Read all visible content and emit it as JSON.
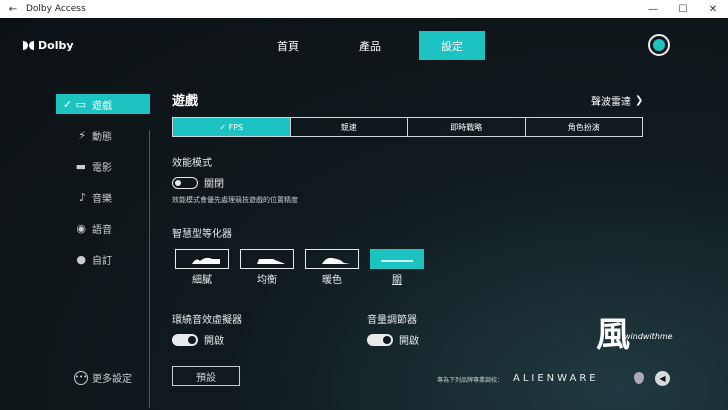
{
  "window": {
    "title": "Dolby Access",
    "back_icon": "back-arrow-icon",
    "controls": [
      "—",
      "☐",
      "✕"
    ]
  },
  "brand": {
    "logo_text": "Dolby",
    "accent": "#1cc3c0"
  },
  "topnav": {
    "tabs": [
      {
        "label": "首頁"
      },
      {
        "label": "產品"
      },
      {
        "label": "設定"
      }
    ],
    "active_index": 2
  },
  "sidebar": {
    "items": [
      {
        "label": "遊戲",
        "icon": "gamepad-icon",
        "active": true
      },
      {
        "label": "動態",
        "icon": "lightning-icon"
      },
      {
        "label": "電影",
        "icon": "clapperboard-icon"
      },
      {
        "label": "音樂",
        "icon": "music-note-icon"
      },
      {
        "label": "語音",
        "icon": "voice-icon"
      },
      {
        "label": "自訂",
        "icon": "user-icon"
      }
    ],
    "more_settings": "更多設定"
  },
  "main": {
    "title": "遊戲",
    "radar_link": "聲波雷達",
    "segments": [
      "FPS",
      "競速",
      "即時戰略",
      "角色扮演"
    ],
    "active_segment": 0,
    "performance_mode": {
      "label": "效能模式",
      "state": "關閉",
      "on": false,
      "description": "效能模式會優先處理競技遊戲的位置精度"
    },
    "equalizer": {
      "label": "智慧型等化器",
      "presets": [
        "細膩",
        "均衡",
        "暖色",
        "關"
      ],
      "active_index": 3
    },
    "surround": {
      "label": "環繞音效虛擬器",
      "state": "開啟",
      "on": true
    },
    "volume_leveler": {
      "label": "音量調節器",
      "state": "開啟",
      "on": true
    },
    "reset_label": "預設"
  },
  "footer": {
    "text": "專為下列品牌專業調校：",
    "brand": "ALIENWARE"
  },
  "watermark": {
    "char": "風",
    "text": "windwithme"
  }
}
